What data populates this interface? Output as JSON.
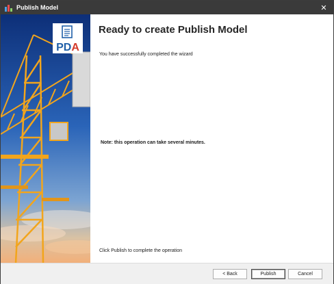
{
  "window": {
    "title": "Publish Model",
    "icon": "publish-app-icon",
    "close_glyph": "✕"
  },
  "side_panel": {
    "logo_text": "PDA",
    "image": "construction-crane-photo"
  },
  "content": {
    "heading": "Ready to create Publish Model",
    "success_message": "You have successfully completed the wizard",
    "note": "Note: this operation can take several minutes.",
    "hint": "Click Publish to complete the operation"
  },
  "buttons": {
    "back_label": "< Back",
    "publish_label": "Publish",
    "cancel_label": "Cancel"
  },
  "colors": {
    "titlebar": "#3a3a3a",
    "crane": "#f2a51c",
    "logo_blue": "#1f5fa8",
    "logo_red": "#d43a2a"
  }
}
